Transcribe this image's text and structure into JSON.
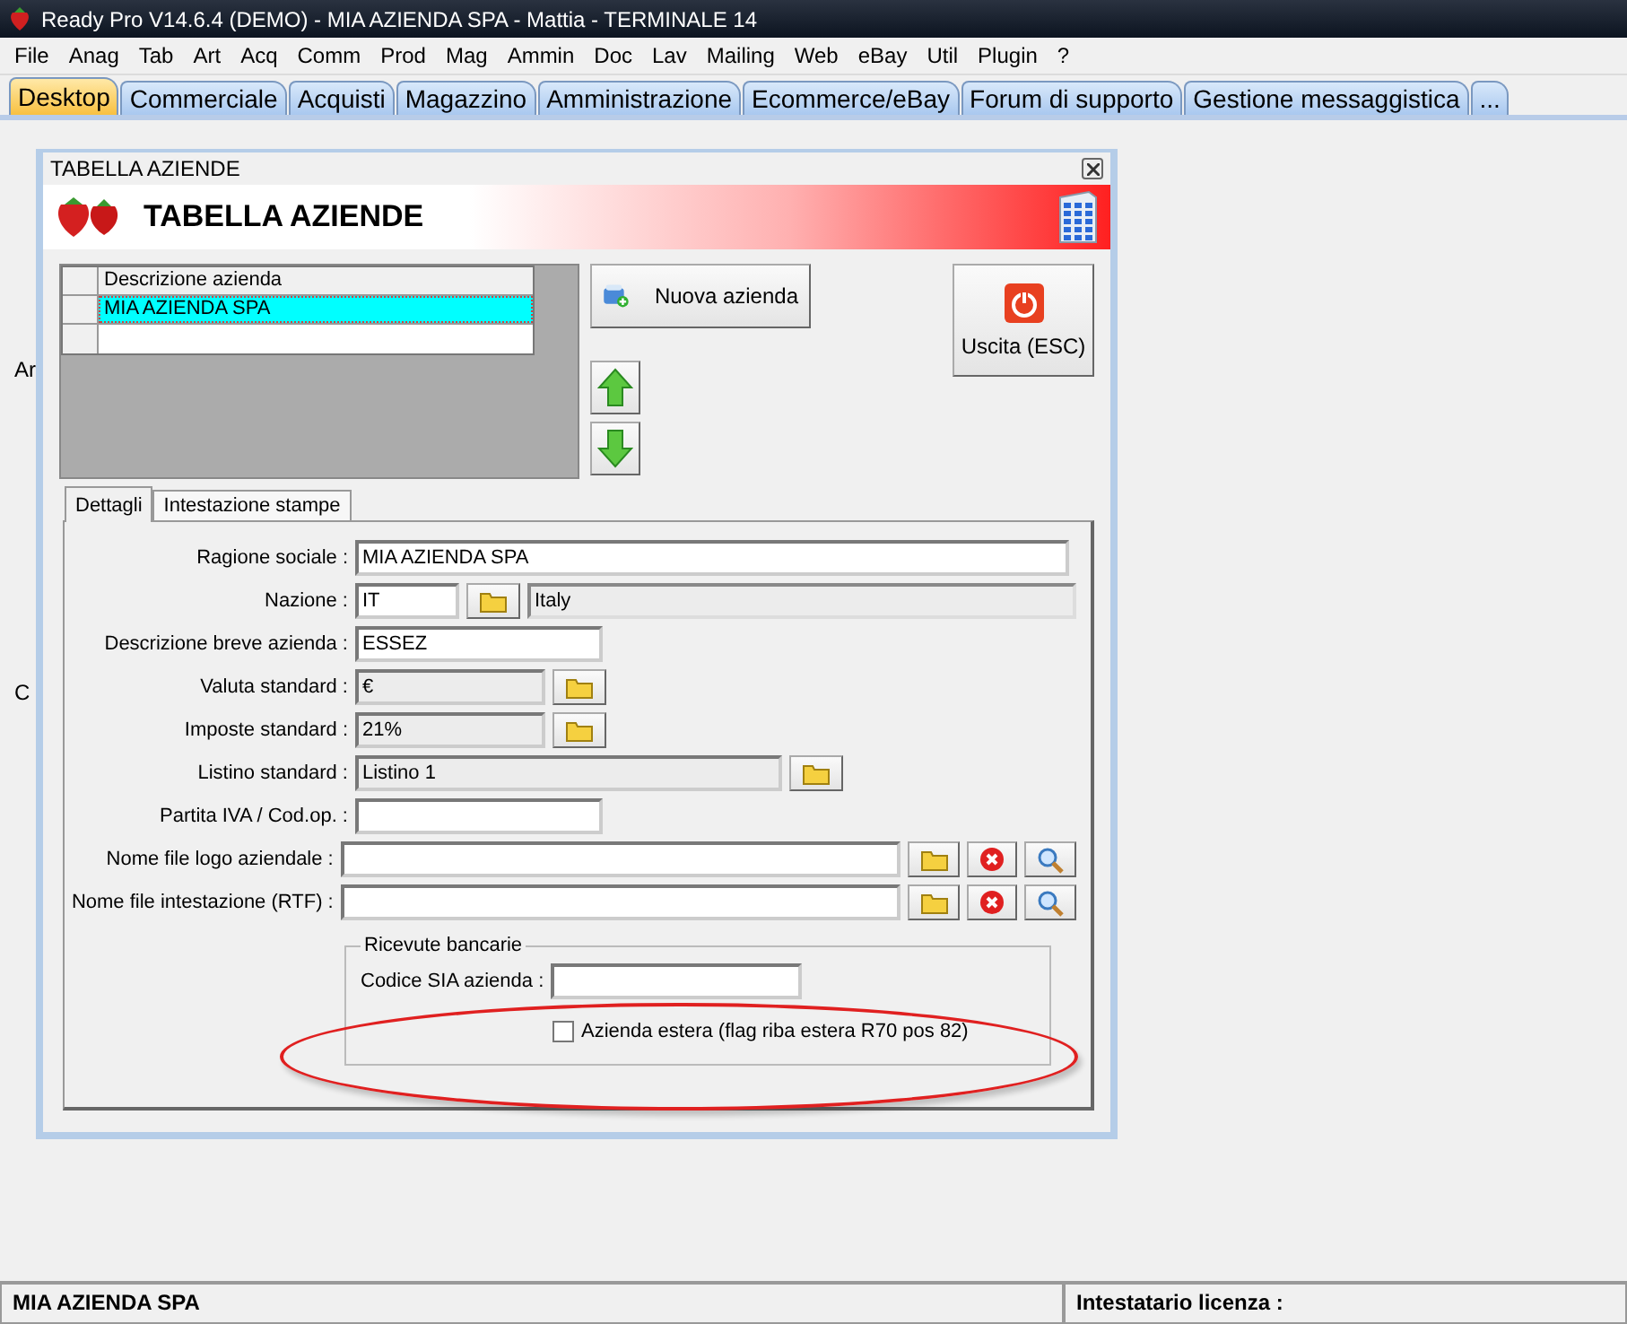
{
  "window": {
    "title": "Ready Pro V14.6.4 (DEMO)  - MIA AZIENDA SPA - Mattia - TERMINALE 14"
  },
  "menu": [
    "File",
    "Anag",
    "Tab",
    "Art",
    "Acq",
    "Comm",
    "Prod",
    "Mag",
    "Ammin",
    "Doc",
    "Lav",
    "Mailing",
    "Web",
    "eBay",
    "Util",
    "Plugin",
    "?"
  ],
  "tabs": [
    {
      "label": "Desktop",
      "selected": true
    },
    {
      "label": "Commerciale",
      "selected": false
    },
    {
      "label": "Acquisti",
      "selected": false
    },
    {
      "label": "Magazzino",
      "selected": false
    },
    {
      "label": "Amministrazione",
      "selected": false
    },
    {
      "label": "Ecommerce/eBay",
      "selected": false
    },
    {
      "label": "Forum di supporto",
      "selected": false
    },
    {
      "label": "Gestione messaggistica",
      "selected": false
    },
    {
      "label": "...",
      "selected": false
    }
  ],
  "desktop_fragments": [
    "Ar",
    "C"
  ],
  "dialog": {
    "title": "TABELLA AZIENDE",
    "header": "TABELLA AZIENDE",
    "grid": {
      "column": "Descrizione azienda",
      "rows": [
        {
          "text": "MIA AZIENDA SPA",
          "selected": true
        }
      ]
    },
    "new_button": "Nuova azienda",
    "exit_button": "Uscita (ESC)",
    "subtabs": [
      {
        "label": "Dettagli",
        "selected": true
      },
      {
        "label": "Intestazione stampe",
        "selected": false
      }
    ],
    "fields": [
      {
        "label": "Ragione sociale :",
        "value": "MIA AZIENDA SPA",
        "readonly": false
      },
      {
        "label": "Nazione :",
        "value": "IT",
        "readonly": false,
        "buttons": [
          {
            "kind": "folder"
          }
        ],
        "extra": "Italy"
      },
      {
        "label": "Descrizione breve azienda :",
        "value": "ESSEZ",
        "readonly": false
      },
      {
        "label": "Valuta standard :",
        "value": "€",
        "readonly": true,
        "buttons": [
          {
            "kind": "folder"
          }
        ]
      },
      {
        "label": "Imposte standard :",
        "value": "21%",
        "readonly": true,
        "buttons": [
          {
            "kind": "folder"
          }
        ]
      },
      {
        "label": "Listino standard :",
        "value": "Listino 1",
        "readonly": true,
        "buttons": [
          {
            "kind": "folder"
          }
        ]
      },
      {
        "label": "Partita IVA / Cod.op. :",
        "readonly": false
      },
      {
        "label": "Nome file logo aziendale :",
        "readonly": false,
        "buttons": [
          {
            "kind": "folder"
          },
          {
            "kind": "clear"
          },
          {
            "kind": "search"
          }
        ]
      },
      {
        "label": "Nome file intestazione (RTF) :",
        "readonly": false,
        "buttons": [
          {
            "kind": "folder"
          },
          {
            "kind": "clear"
          },
          {
            "kind": "search"
          }
        ]
      }
    ],
    "bank_group": {
      "title": "Ricevute bancarie",
      "sia_label": "Codice SIA azienda :",
      "checkbox": {
        "label": "Azienda estera (flag riba estera R70 pos 82)",
        "checked": false
      }
    },
    "highlight": {
      "kind": "ellipse"
    }
  },
  "status_bar": [
    "MIA AZIENDA SPA",
    "Intestatario licenza :"
  ]
}
